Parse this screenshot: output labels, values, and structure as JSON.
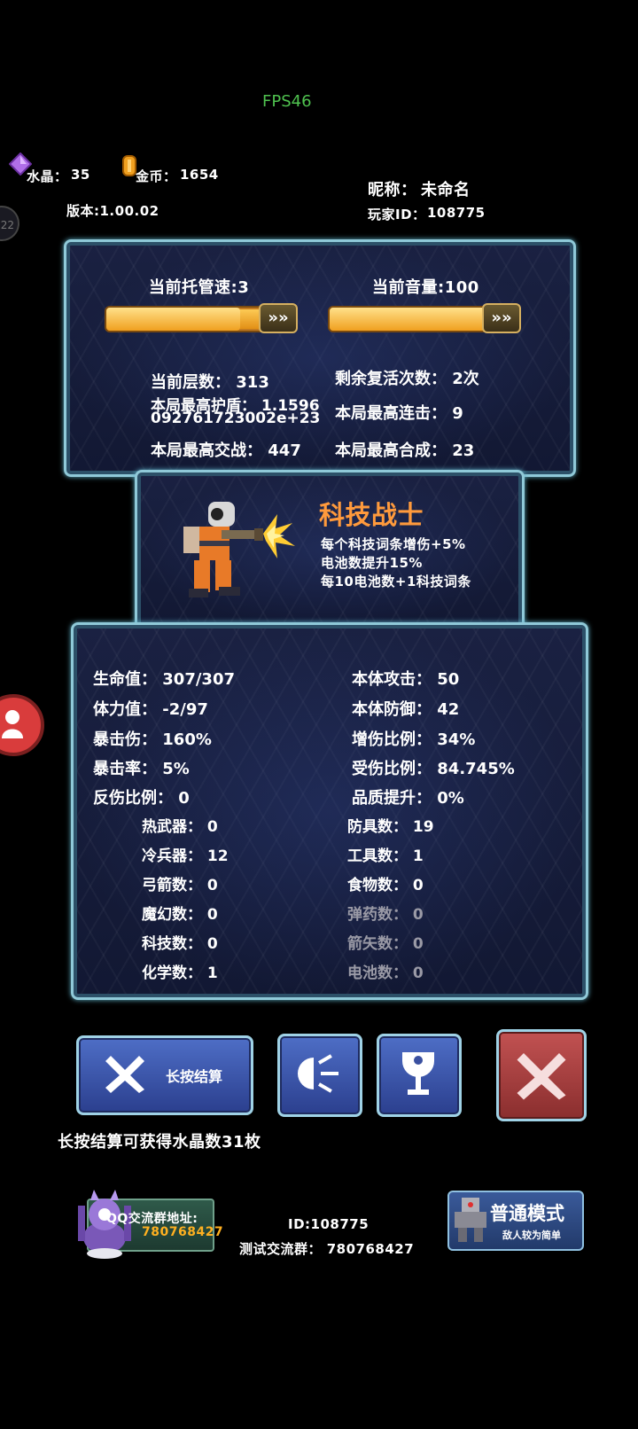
{
  "fps": "FPS46",
  "currency": {
    "crystal_label": "水晶：",
    "crystal_value": "35",
    "gold_label": "金币：",
    "gold_value": "1654"
  },
  "version": "版本:1.00.02",
  "player": {
    "nick_label": "昵称：",
    "nick_value": "未命名",
    "id_label": "玩家ID：",
    "id_value": "108775"
  },
  "side_badge": "22",
  "settings": {
    "speed_label": "当前托管速:3",
    "volume_label": "当前音量:100",
    "speed_level": 0.85,
    "volume_level": 1.0,
    "arrows": "»»"
  },
  "run_stats": {
    "floor": "当前层数：  313",
    "revives": "剩余复活次数：  2次",
    "max_shield_1": "本局最高护盾：  1.1596",
    "max_shield_2": "092761723002e+23",
    "max_combo": "本局最高连击：  9",
    "max_battle": "本局最高交战：  447",
    "max_merge": "本局最高合成：  23"
  },
  "character": {
    "name": "科技战士",
    "desc_1": "每个科技词条增伤+5%",
    "desc_2": "电池数提升15%",
    "desc_3": "每10电池数+1科技词条"
  },
  "stats_left": [
    {
      "text": "生命值：  307/307"
    },
    {
      "text": "体力值：  -2/97"
    },
    {
      "text": "暴击伤：  160%"
    },
    {
      "text": "暴击率：  5%"
    },
    {
      "text": "反伤比例：  0"
    }
  ],
  "stats_right": [
    {
      "text": "本体攻击：  50"
    },
    {
      "text": "本体防御：  42"
    },
    {
      "text": "增伤比例：  34%"
    },
    {
      "text": "受伤比例：  84.745%"
    },
    {
      "text": "品质提升：  0%"
    }
  ],
  "items_left": [
    {
      "text": "热武器：  0"
    },
    {
      "text": "冷兵器：  12"
    },
    {
      "text": "弓箭数：  0"
    },
    {
      "text": "魔幻数：  0"
    },
    {
      "text": "科技数：  0"
    },
    {
      "text": "化学数：  1"
    }
  ],
  "items_right": [
    {
      "text": "防具数：  19"
    },
    {
      "text": "工具数：  1"
    },
    {
      "text": "食物数：  0"
    },
    {
      "text": "弹药数：  0"
    },
    {
      "text": "箭矢数：  0"
    },
    {
      "text": "电池数：  0"
    }
  ],
  "buttons": {
    "settle_label": "长按结算"
  },
  "settle_hint": "长按结算可获得水晶数31枚",
  "qq": {
    "label": "QQ交流群地址:",
    "number": "780768427"
  },
  "footer": {
    "id": "ID:108775",
    "group": "测试交流群：  780768427"
  },
  "mode": {
    "title": "普通模式",
    "subtitle": "敌人较为简单"
  },
  "colors": {
    "fps": "#4fc24f",
    "character_name": "#ff9a3c",
    "qq_number": "#ffb020",
    "disabled_text": "#9a9aa6"
  }
}
